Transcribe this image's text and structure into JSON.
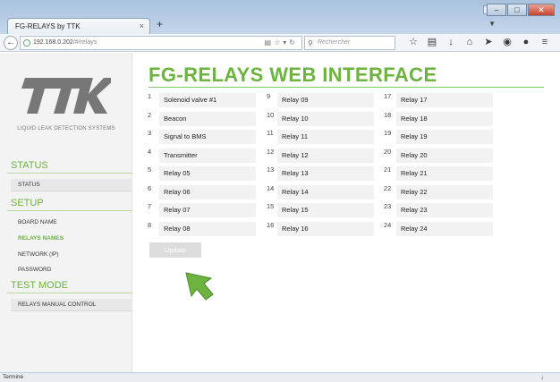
{
  "browser": {
    "tab_title": "FG-RELAYS by TTK",
    "tab_close": "×",
    "new_tab": "+",
    "url_host": "192.168.0.202",
    "url_path": "/#/relays",
    "search_placeholder": "Rechercher",
    "status_text": "Terminé"
  },
  "sidebar": {
    "tagline": "LIQUID LEAK DETECTION SYSTEMS",
    "sections": {
      "status": "STATUS",
      "setup": "SETUP",
      "test": "TEST MODE"
    },
    "items": {
      "status": "STATUS",
      "board_name": "BOARD NAME",
      "relays_names": "RELAYS NAMES",
      "network": "NETWORK (IP)",
      "password": "PASSWORD",
      "relays_manual": "RELAYS MANUAL CONTROL"
    }
  },
  "main": {
    "title": "FG-RELAYS WEB INTERFACE",
    "update_label": "Update",
    "relays": [
      {
        "num": "1",
        "name": "Solenoid valve #1"
      },
      {
        "num": "2",
        "name": "Beacon"
      },
      {
        "num": "3",
        "name": "Signal to BMS"
      },
      {
        "num": "4",
        "name": "Transmitter"
      },
      {
        "num": "5",
        "name": "Relay 05"
      },
      {
        "num": "6",
        "name": "Relay 06"
      },
      {
        "num": "7",
        "name": "Relay 07"
      },
      {
        "num": "8",
        "name": "Relay 08"
      },
      {
        "num": "9",
        "name": "Relay 09"
      },
      {
        "num": "10",
        "name": "Relay 10"
      },
      {
        "num": "11",
        "name": "Relay 11"
      },
      {
        "num": "12",
        "name": "Relay 12"
      },
      {
        "num": "13",
        "name": "Relay 13"
      },
      {
        "num": "14",
        "name": "Relay 14"
      },
      {
        "num": "15",
        "name": "Relay 15"
      },
      {
        "num": "16",
        "name": "Relay 16"
      },
      {
        "num": "17",
        "name": "Relay 17"
      },
      {
        "num": "18",
        "name": "Relay 18"
      },
      {
        "num": "19",
        "name": "Relay 19"
      },
      {
        "num": "20",
        "name": "Relay 20"
      },
      {
        "num": "21",
        "name": "Relay 21"
      },
      {
        "num": "22",
        "name": "Relay 22"
      },
      {
        "num": "23",
        "name": "Relay 23"
      },
      {
        "num": "24",
        "name": "Relay 24"
      }
    ]
  },
  "colors": {
    "accent": "#6cb33f",
    "logo": "#777777"
  },
  "logo_text": "TTK"
}
